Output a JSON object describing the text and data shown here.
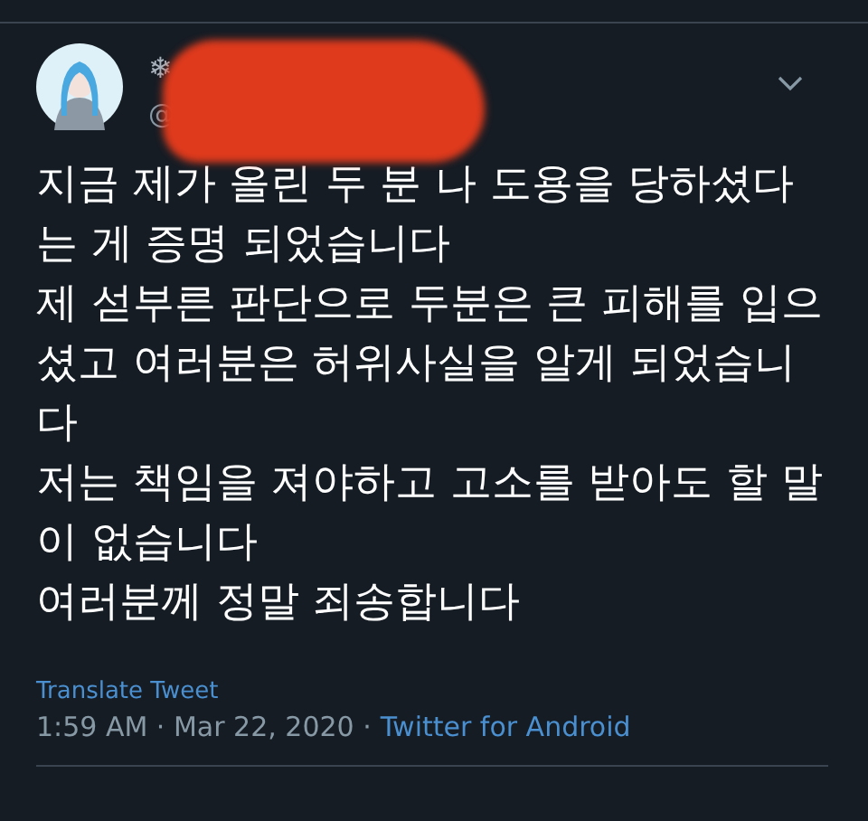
{
  "tweet": {
    "author": {
      "name_mark": "❄",
      "handle": "@",
      "redacted": true
    },
    "paragraphs": [
      "지금 제가 올린 두 분 나 도용을 당하셨다는 게 증명 되었습니다",
      "제 섣부른 판단으로 두분은 큰 피해를 입으셨고 여러분은 허위사실을 알게 되었습니다",
      "저는 책임을 져야하고 고소를 받아도 할 말이 없습니다",
      "여러분께 정말 죄송합니다"
    ],
    "translate_link": "Translate Tweet",
    "time": "1:59 AM · Mar 22, 2020 ·",
    "source": "Twitter for Android"
  }
}
